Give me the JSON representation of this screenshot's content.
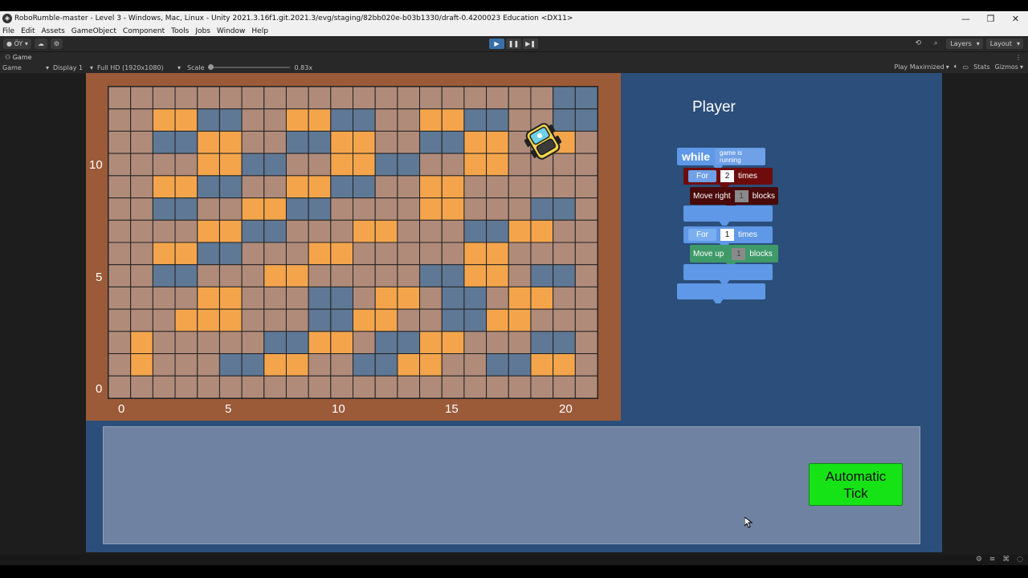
{
  "window": {
    "title": "RoboRumble-master - Level 3 - Windows, Mac, Linux - Unity 2021.3.16f1.git.2021.3/evg/staging/82bb020e-b03b1330/draft-0.4200023 Education <DX11>",
    "minimize": "—",
    "restore": "❐",
    "close": "✕"
  },
  "menu": [
    "File",
    "Edit",
    "Assets",
    "GameObject",
    "Component",
    "Tools",
    "Jobs",
    "Window",
    "Help"
  ],
  "toolbar": {
    "account": "ÖY",
    "play": "▶",
    "pause": "❚❚",
    "step": "▶❚",
    "layers": "Layers",
    "layout": "Layout"
  },
  "gameTab": {
    "label": "Game",
    "icon": "gamepad-icon"
  },
  "gameBar": {
    "mode": "Game",
    "display": "Display 1",
    "resolution": "Full HD (1920x1080)",
    "scaleLabel": "Scale",
    "scaleValue": "0.83x",
    "playMaximized": "Play Maximized",
    "stats": "Stats",
    "gizmos": "Gizmos"
  },
  "board": {
    "cols": 22,
    "rows": 14,
    "yLabels": [
      "10",
      "5",
      "0"
    ],
    "xLabels": [
      "0",
      "5",
      "10",
      "15",
      "20"
    ],
    "colors": {
      "brown": "#b08b7a",
      "orange": "#f4a54c",
      "blue": "#5f7895",
      "frame": "#9b5a38"
    },
    "cells": [
      "BBBBBBBBBBBBBBBBBBBBLL",
      "BBOOLLBBOOLLBBOOLLBBLL",
      "BBLLOOBBLLOOBBLLOOBBOB",
      "BBBBOOLLBBOOLLBBOOBBBB",
      "BBOOLLBBOOLLBBOOBBBBBB",
      "BBLLBBOOLLBBBBOOBBBLLB",
      "BBBBOOLLBBBOOBBBLLOOBB",
      "BBOOLLBBBOOBBBBBOOBBBB",
      "BBLLBBBOOBBBBBLLOOBLLB",
      "BBBBOOBBBLLBOOBLLBOOBB",
      "BBBOOOBBBLLOOBBLLOOBBB",
      "BOBBBBBLLOOBLLOOBBBLLB",
      "BOBBBLLOOBBLLOOBBLLOOB",
      "BBBBBBBBBBBBBBBBBBBBBB"
    ]
  },
  "panel": {
    "title": "Player",
    "whileBlock": {
      "keyword": "while",
      "condition": "game is running"
    },
    "for1": {
      "keyword": "For",
      "count": "2",
      "suffix": "times"
    },
    "moveRight": {
      "label": "Move right",
      "count": "1",
      "suffix": "blocks"
    },
    "for2": {
      "keyword": "For",
      "count": "1",
      "suffix": "times"
    },
    "moveUp": {
      "label": "Move up",
      "count": "1",
      "suffix": "blocks"
    }
  },
  "autoTick": {
    "line1": "Automatic",
    "line2": "Tick"
  }
}
